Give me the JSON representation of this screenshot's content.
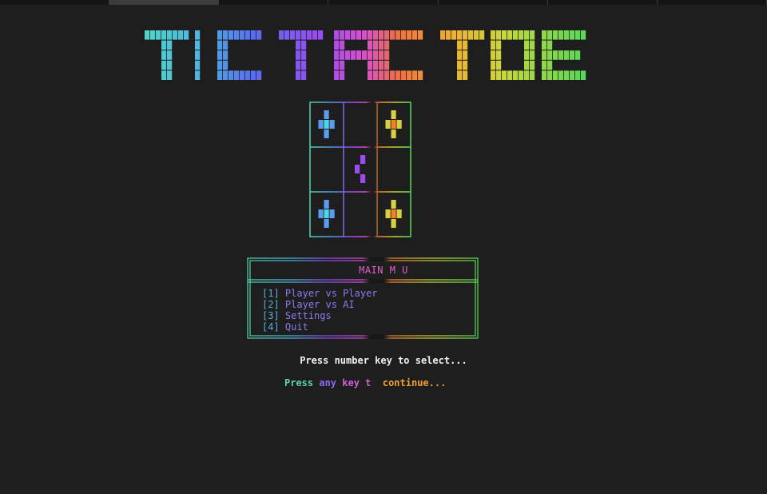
{
  "window": {
    "tabs": [
      "",
      "",
      "",
      "",
      "",
      "",
      ""
    ],
    "active_tab": 1
  },
  "title": {
    "text": "TIC TAC TOE"
  },
  "board": {
    "cells": [
      "X",
      "",
      "X",
      "",
      "O",
      "",
      "X",
      "",
      "X"
    ]
  },
  "menu": {
    "title": "MAIN M  U",
    "items": [
      {
        "key": "[1]",
        "label": "Player vs Player"
      },
      {
        "key": "[2]",
        "label": "Player vs AI"
      },
      {
        "key": "[3]",
        "label": "Settings"
      },
      {
        "key": "[4]",
        "label": "Quit"
      }
    ]
  },
  "prompt": "Press number key to select...",
  "continue_prompt": {
    "parts": [
      "Press ",
      "any ",
      "key ",
      "t  ",
      "continue..."
    ]
  },
  "colors": {
    "background": "#1e1e1e",
    "cyan": "#4fb3d9",
    "teal": "#58d6a8",
    "blue": "#5a7cf0",
    "violet": "#8a5cf0",
    "magenta": "#e060d0",
    "orange": "#f08030",
    "yellow": "#d8d040",
    "green": "#78d848"
  }
}
